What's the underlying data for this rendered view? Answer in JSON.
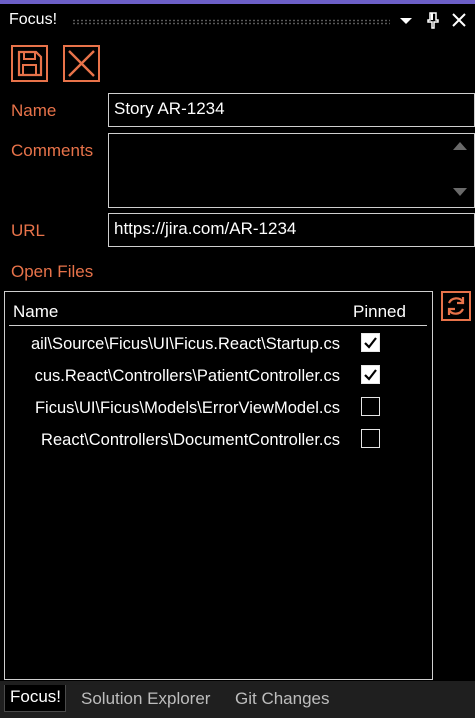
{
  "window": {
    "title": "Focus!",
    "accent_color": "#e8734a",
    "top_accent": "#6c5fc7",
    "controls": [
      "chevron-down-icon",
      "pin-icon",
      "close-icon"
    ]
  },
  "toolbar": {
    "save_icon": "floppy-disk-icon",
    "cancel_icon": "x-icon"
  },
  "form": {
    "name_label": "Name",
    "name_value": "Story AR-1234",
    "comments_label": "Comments",
    "comments_value": "",
    "url_label": "URL",
    "url_value": "https://jira.com/AR-1234"
  },
  "open_files": {
    "label": "Open Files",
    "columns": {
      "name": "Name",
      "pinned": "Pinned"
    },
    "rows": [
      {
        "path": "ail\\Source\\Ficus\\UI\\Ficus.React\\Startup.cs",
        "pinned": true
      },
      {
        "path": "cus.React\\Controllers\\PatientController.cs",
        "pinned": true
      },
      {
        "path": "Ficus\\UI\\Ficus\\Models\\ErrorViewModel.cs",
        "pinned": false
      },
      {
        "path": "React\\Controllers\\DocumentController.cs",
        "pinned": false
      }
    ],
    "refresh_icon": "refresh-icon"
  },
  "tabs": [
    {
      "label": "Focus!",
      "active": true
    },
    {
      "label": "Solution Explorer",
      "active": false
    },
    {
      "label": "Git Changes",
      "active": false
    }
  ]
}
